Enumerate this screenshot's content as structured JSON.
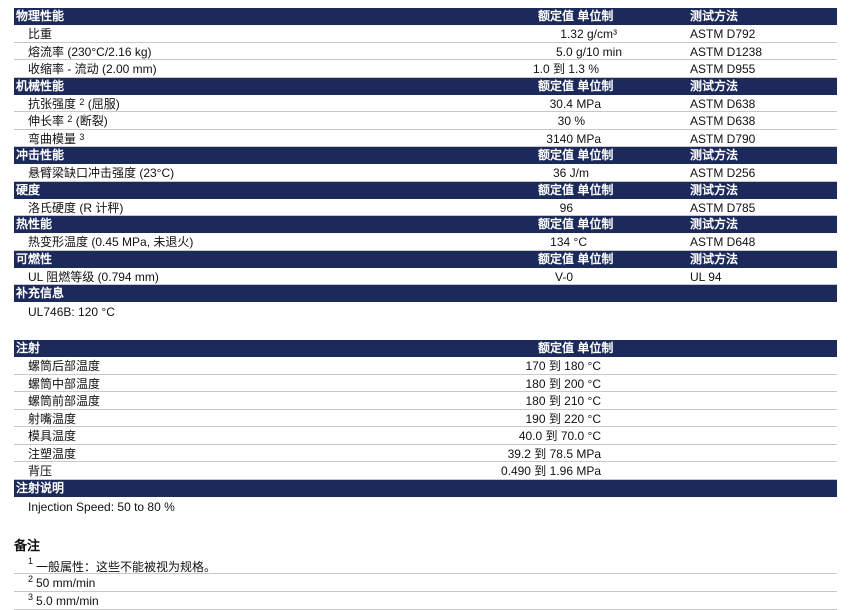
{
  "sections": [
    {
      "title": "物理性能",
      "col_value": "额定值 单位制",
      "col_test": "测试方法",
      "rows": [
        {
          "name": "比重",
          "value": "1.32 g/cm³",
          "test": "ASTM D792"
        },
        {
          "name": "熔流率 (230°C/2.16 kg)",
          "value": "5.0 g/10 min",
          "test": "ASTM D1238"
        },
        {
          "name": "收缩率 - 流动 (2.00 mm)",
          "value": "1.0 到 1.3 %",
          "test": "ASTM D955"
        }
      ]
    },
    {
      "title": "机械性能",
      "col_value": "额定值 单位制",
      "col_test": "测试方法",
      "rows": [
        {
          "name": "抗张强度",
          "sup": "2",
          "name2": " (屈服)",
          "value": "30.4 MPa",
          "test": "ASTM D638"
        },
        {
          "name": "伸长率",
          "sup": "2",
          "name2": " (断裂)",
          "value": "30 %",
          "test": "ASTM D638"
        },
        {
          "name": "弯曲模量",
          "sup": "3",
          "name2": "",
          "value": "3140 MPa",
          "test": "ASTM D790"
        }
      ]
    },
    {
      "title": "冲击性能",
      "col_value": "额定值 单位制",
      "col_test": "测试方法",
      "rows": [
        {
          "name": "悬臂梁缺口冲击强度 (23°C)",
          "value": "36 J/m",
          "test": "ASTM D256"
        }
      ]
    },
    {
      "title": "硬度",
      "col_value": "额定值 单位制",
      "col_test": "测试方法",
      "rows": [
        {
          "name": "洛氏硬度 (R 计秤)",
          "value": "96",
          "test": "ASTM D785"
        }
      ]
    },
    {
      "title": "热性能",
      "col_value": "额定值 单位制",
      "col_test": "测试方法",
      "rows": [
        {
          "name": "热变形温度 (0.45 MPa, 未退火)",
          "value": "134 °C",
          "test": "ASTM D648"
        }
      ]
    },
    {
      "title": "可燃性",
      "col_value": "额定值 单位制",
      "col_test": "测试方法",
      "rows": [
        {
          "name": "UL 阻燃等级 (0.794 mm)",
          "value": "V-0",
          "test": "UL 94"
        }
      ]
    }
  ],
  "supplement": {
    "title": "补充信息",
    "text": "UL746B: 120 °C"
  },
  "injection": {
    "title": "注射",
    "col_value": "额定值 单位制",
    "rows": [
      {
        "name": "螺筒后部温度",
        "value": "170 到 180 °C"
      },
      {
        "name": "螺筒中部温度",
        "value": "180 到 200 °C"
      },
      {
        "name": "螺筒前部温度",
        "value": "180 到 210 °C"
      },
      {
        "name": "射嘴温度",
        "value": "190 到 220 °C"
      },
      {
        "name": "模具温度",
        "value": "40.0 到 70.0 °C"
      },
      {
        "name": "注塑温度",
        "value": "39.2 到 78.5 MPa"
      },
      {
        "name": "背压",
        "value": "0.490 到 1.96 MPa"
      }
    ]
  },
  "injection_note": {
    "title": "注射说明",
    "text": "Injection Speed: 50 to 80 %"
  },
  "notes": {
    "title": "备注",
    "items": [
      {
        "num": "1",
        "text": "一般属性：这些不能被视为规格。"
      },
      {
        "num": "2",
        "text": "50 mm/min"
      },
      {
        "num": "3",
        "text": "5.0 mm/min"
      }
    ]
  }
}
